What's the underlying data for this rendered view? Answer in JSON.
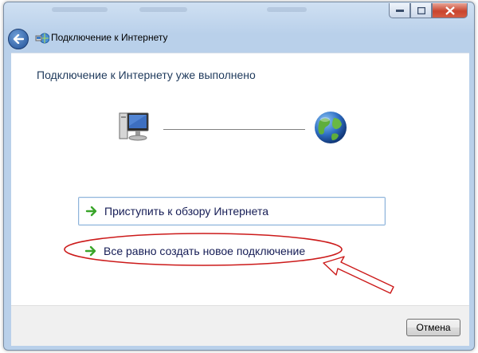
{
  "window": {
    "title": "Подключение к Интернету"
  },
  "main": {
    "heading": "Подключение к Интернету уже выполнено",
    "options": [
      {
        "label": "Приступить к обзору Интернета",
        "icon": "green-arrow-icon"
      },
      {
        "label": "Все равно создать новое подключение",
        "icon": "green-arrow-icon"
      }
    ]
  },
  "footer": {
    "cancel_label": "Отмена"
  },
  "icons": {
    "back": "back-arrow-icon",
    "header": "network-connection-icon",
    "computer": "computer-icon",
    "internet": "globe-icon",
    "annotation_circle": "red-ellipse",
    "annotation_arrow": "red-pointer-arrow"
  },
  "colors": {
    "heading": "#1e395b",
    "link_text": "#151c55",
    "annotation": "#cc1a1a",
    "option_arrow": "#3aa52a"
  }
}
